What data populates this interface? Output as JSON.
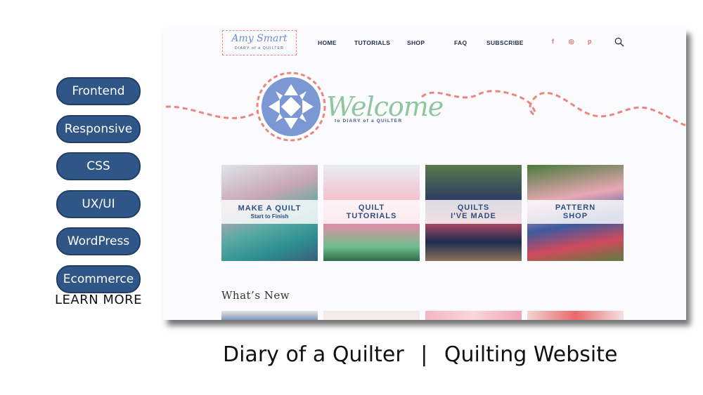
{
  "tags": [
    "Frontend",
    "Responsive",
    "CSS",
    "UX/UI",
    "WordPress",
    "Ecommerce"
  ],
  "learn_more": "LEARN MORE",
  "caption": {
    "site": "Diary of a Quilter",
    "separator": "|",
    "description": "Quilting Website"
  },
  "site": {
    "logo": {
      "script": "Amy Smart",
      "tagline": "DIARY of a QUILTER"
    },
    "nav": [
      "HOME",
      "TUTORIALS",
      "SHOP",
      "FAQ",
      "SUBSCRIBE"
    ],
    "social": [
      "f",
      "◎",
      "p"
    ],
    "welcome": {
      "title": "Welcome",
      "subtitle": "to DIARY of a QUILTER"
    },
    "cards": [
      {
        "title": "MAKE A QUILT",
        "sub": "Start to Finish"
      },
      {
        "title": "QUILT\nTUTORIALS",
        "sub": ""
      },
      {
        "title": "QUILTS\nI'VE MADE",
        "sub": ""
      },
      {
        "title": "PATTERN\nSHOP",
        "sub": ""
      }
    ],
    "whats_new": "What’s New"
  },
  "colors": {
    "pill": "#2f5686",
    "accent_coral": "#e98680",
    "accent_green": "#8fc6a0",
    "brand_blue": "#2e4f82"
  }
}
